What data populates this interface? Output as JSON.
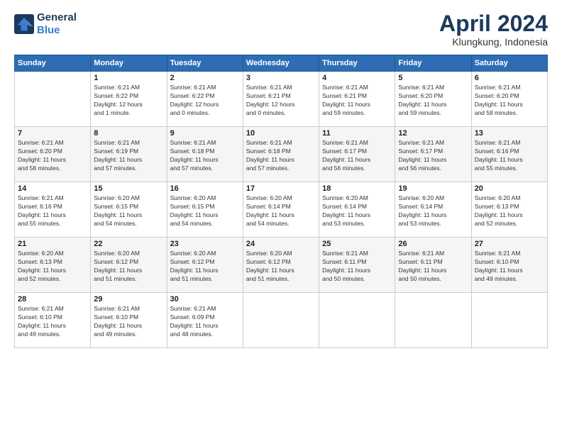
{
  "logo": {
    "line1": "General",
    "line2": "Blue"
  },
  "title": "April 2024",
  "subtitle": "Klungkung, Indonesia",
  "days_header": [
    "Sunday",
    "Monday",
    "Tuesday",
    "Wednesday",
    "Thursday",
    "Friday",
    "Saturday"
  ],
  "weeks": [
    [
      {
        "num": "",
        "info": ""
      },
      {
        "num": "1",
        "info": "Sunrise: 6:21 AM\nSunset: 6:22 PM\nDaylight: 12 hours\nand 1 minute."
      },
      {
        "num": "2",
        "info": "Sunrise: 6:21 AM\nSunset: 6:22 PM\nDaylight: 12 hours\nand 0 minutes."
      },
      {
        "num": "3",
        "info": "Sunrise: 6:21 AM\nSunset: 6:21 PM\nDaylight: 12 hours\nand 0 minutes."
      },
      {
        "num": "4",
        "info": "Sunrise: 6:21 AM\nSunset: 6:21 PM\nDaylight: 11 hours\nand 59 minutes."
      },
      {
        "num": "5",
        "info": "Sunrise: 6:21 AM\nSunset: 6:20 PM\nDaylight: 11 hours\nand 59 minutes."
      },
      {
        "num": "6",
        "info": "Sunrise: 6:21 AM\nSunset: 6:20 PM\nDaylight: 11 hours\nand 58 minutes."
      }
    ],
    [
      {
        "num": "7",
        "info": "Sunrise: 6:21 AM\nSunset: 6:20 PM\nDaylight: 11 hours\nand 58 minutes."
      },
      {
        "num": "8",
        "info": "Sunrise: 6:21 AM\nSunset: 6:19 PM\nDaylight: 11 hours\nand 57 minutes."
      },
      {
        "num": "9",
        "info": "Sunrise: 6:21 AM\nSunset: 6:18 PM\nDaylight: 11 hours\nand 57 minutes."
      },
      {
        "num": "10",
        "info": "Sunrise: 6:21 AM\nSunset: 6:18 PM\nDaylight: 11 hours\nand 57 minutes."
      },
      {
        "num": "11",
        "info": "Sunrise: 6:21 AM\nSunset: 6:17 PM\nDaylight: 11 hours\nand 56 minutes."
      },
      {
        "num": "12",
        "info": "Sunrise: 6:21 AM\nSunset: 6:17 PM\nDaylight: 11 hours\nand 56 minutes."
      },
      {
        "num": "13",
        "info": "Sunrise: 6:21 AM\nSunset: 6:16 PM\nDaylight: 11 hours\nand 55 minutes."
      }
    ],
    [
      {
        "num": "14",
        "info": "Sunrise: 6:21 AM\nSunset: 6:16 PM\nDaylight: 11 hours\nand 55 minutes."
      },
      {
        "num": "15",
        "info": "Sunrise: 6:20 AM\nSunset: 6:15 PM\nDaylight: 11 hours\nand 54 minutes."
      },
      {
        "num": "16",
        "info": "Sunrise: 6:20 AM\nSunset: 6:15 PM\nDaylight: 11 hours\nand 54 minutes."
      },
      {
        "num": "17",
        "info": "Sunrise: 6:20 AM\nSunset: 6:14 PM\nDaylight: 11 hours\nand 54 minutes."
      },
      {
        "num": "18",
        "info": "Sunrise: 6:20 AM\nSunset: 6:14 PM\nDaylight: 11 hours\nand 53 minutes."
      },
      {
        "num": "19",
        "info": "Sunrise: 6:20 AM\nSunset: 6:14 PM\nDaylight: 11 hours\nand 53 minutes."
      },
      {
        "num": "20",
        "info": "Sunrise: 6:20 AM\nSunset: 6:13 PM\nDaylight: 11 hours\nand 52 minutes."
      }
    ],
    [
      {
        "num": "21",
        "info": "Sunrise: 6:20 AM\nSunset: 6:13 PM\nDaylight: 11 hours\nand 52 minutes."
      },
      {
        "num": "22",
        "info": "Sunrise: 6:20 AM\nSunset: 6:12 PM\nDaylight: 11 hours\nand 51 minutes."
      },
      {
        "num": "23",
        "info": "Sunrise: 6:20 AM\nSunset: 6:12 PM\nDaylight: 11 hours\nand 51 minutes."
      },
      {
        "num": "24",
        "info": "Sunrise: 6:20 AM\nSunset: 6:12 PM\nDaylight: 11 hours\nand 51 minutes."
      },
      {
        "num": "25",
        "info": "Sunrise: 6:21 AM\nSunset: 6:11 PM\nDaylight: 11 hours\nand 50 minutes."
      },
      {
        "num": "26",
        "info": "Sunrise: 6:21 AM\nSunset: 6:11 PM\nDaylight: 11 hours\nand 50 minutes."
      },
      {
        "num": "27",
        "info": "Sunrise: 6:21 AM\nSunset: 6:10 PM\nDaylight: 11 hours\nand 49 minutes."
      }
    ],
    [
      {
        "num": "28",
        "info": "Sunrise: 6:21 AM\nSunset: 6:10 PM\nDaylight: 11 hours\nand 49 minutes."
      },
      {
        "num": "29",
        "info": "Sunrise: 6:21 AM\nSunset: 6:10 PM\nDaylight: 11 hours\nand 49 minutes."
      },
      {
        "num": "30",
        "info": "Sunrise: 6:21 AM\nSunset: 6:09 PM\nDaylight: 11 hours\nand 48 minutes."
      },
      {
        "num": "",
        "info": ""
      },
      {
        "num": "",
        "info": ""
      },
      {
        "num": "",
        "info": ""
      },
      {
        "num": "",
        "info": ""
      }
    ]
  ]
}
